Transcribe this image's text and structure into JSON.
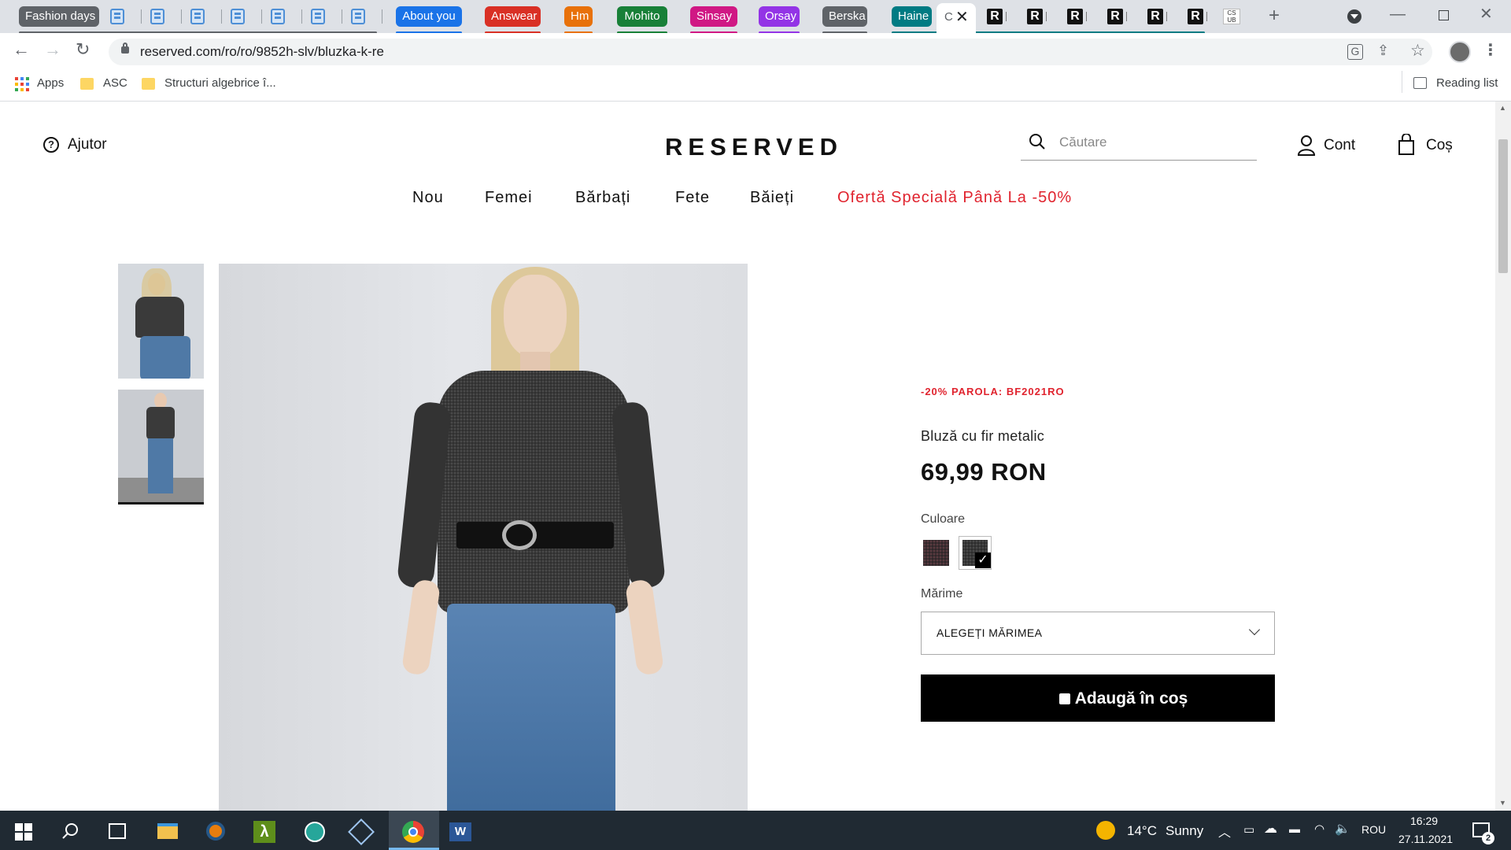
{
  "browser": {
    "tab_groups": [
      {
        "label": "Fashion days",
        "color": "#5f6368"
      },
      {
        "label": "About you",
        "color": "#1a73e8"
      },
      {
        "label": "Answear",
        "color": "#d93025"
      },
      {
        "label": "Hm",
        "color": "#e8710a"
      },
      {
        "label": "Mohito",
        "color": "#188038"
      },
      {
        "label": "Sinsay",
        "color": "#d01884"
      },
      {
        "label": "Orsay",
        "color": "#9334e6"
      },
      {
        "label": "Berska",
        "color": "#5f6368"
      },
      {
        "label": "Haine",
        "color": "#007b83"
      }
    ],
    "active_tab_glyph": "C",
    "r_tab_glyph": "R",
    "cs_tab_glyph": "CS UB",
    "url": "reserved.com/ro/ro/9852h-slv/bluzka-k-re",
    "bookmarks": [
      {
        "label": "Apps",
        "icon": "apps-grid-icon"
      },
      {
        "label": "ASC",
        "icon": "folder-icon"
      },
      {
        "label": "Structuri algebrice î...",
        "icon": "folder-icon"
      }
    ],
    "reading_list": "Reading list"
  },
  "site": {
    "help": "Ajutor",
    "logo": "RESERVED",
    "search_placeholder": "Căutare",
    "account": "Cont",
    "cart": "Coș",
    "nav": [
      "Nou",
      "Femei",
      "Bărbați",
      "Fete",
      "Băieți"
    ],
    "promo_nav": "Ofertă Specială Până La -50%",
    "accent_red": "#e0232e"
  },
  "product": {
    "promo_code": "-20% PAROLA: BF2021RO",
    "name": "Bluză cu fir metalic",
    "price": "69,99 RON",
    "color_label": "Culoare",
    "size_label": "Mărime",
    "size_select": "ALEGEȚI MĂRIMEA",
    "add_to_cart": "Adaugă în coș"
  },
  "taskbar": {
    "weather_temp": "14°C",
    "weather_text": "Sunny",
    "language": "ROU",
    "time": "16:29",
    "date": "27.11.2021",
    "notification_count": "2"
  }
}
